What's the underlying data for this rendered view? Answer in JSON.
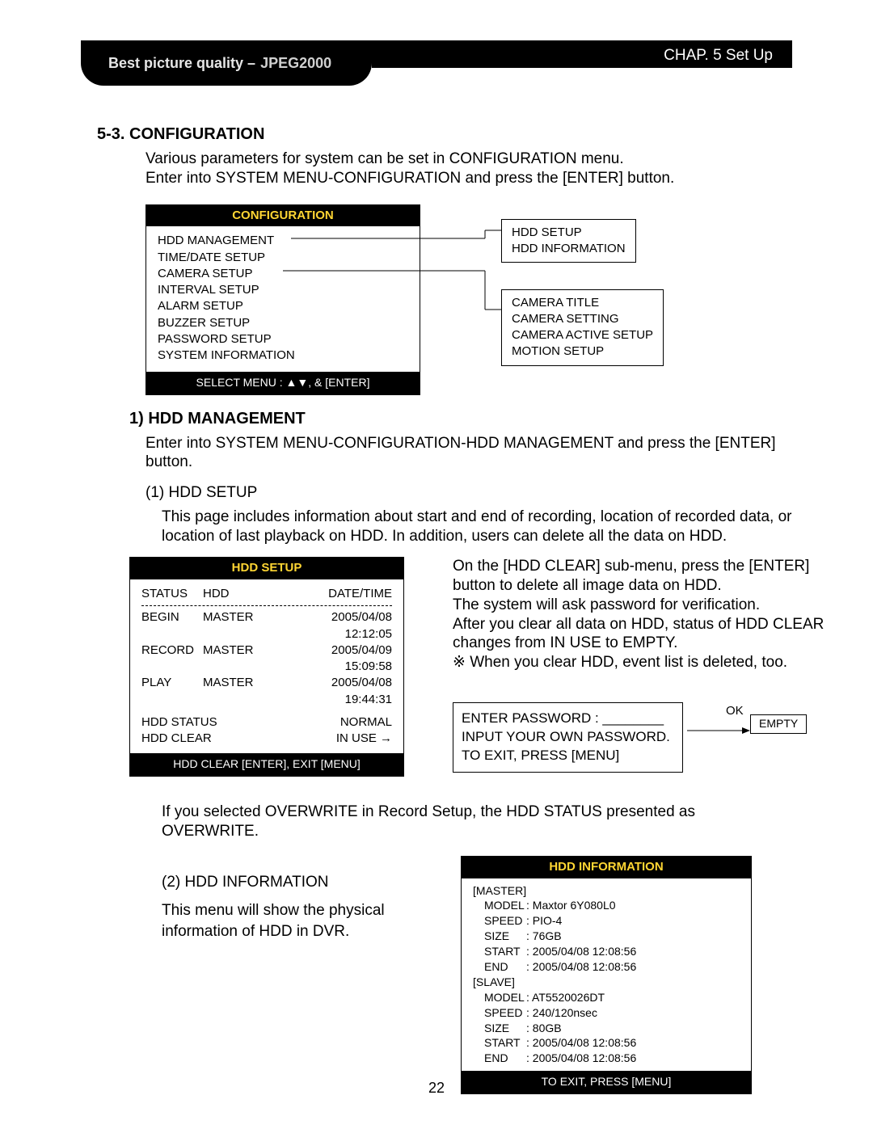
{
  "header": {
    "tagline_prefix": "Best picture quality – ",
    "tagline_em": "JPEG2000",
    "chapter": "CHAP. 5  Set Up"
  },
  "section": {
    "title": "5-3. CONFIGURATION",
    "intro": "Various parameters for system can be set in CONFIGURATION menu.\nEnter into SYSTEM MENU-CONFIGURATION and press the [ENTER] button."
  },
  "cfg_menu": {
    "title": "CONFIGURATION",
    "items": [
      "HDD MANAGEMENT",
      "TIME/DATE SETUP",
      "CAMERA SETUP",
      "INTERVAL SETUP",
      "ALARM SETUP",
      "BUZZER SETUP",
      "PASSWORD SETUP",
      "SYSTEM INFORMATION"
    ],
    "footer": "SELECT MENU : ▲▼, & [ENTER]",
    "sub_hdd": [
      "HDD SETUP",
      "HDD INFORMATION"
    ],
    "sub_cam": [
      "CAMERA TITLE",
      "CAMERA SETTING",
      "CAMERA ACTIVE SETUP",
      "MOTION SETUP"
    ]
  },
  "hdd_section": {
    "title": "1) HDD MANAGEMENT",
    "intro": "Enter into SYSTEM MENU-CONFIGURATION-HDD MANAGEMENT and press the [ENTER] button.",
    "sub1_label": "(1) HDD SETUP",
    "sub1_para": "This page includes information about start and end of recording, location of recorded data, or location of last playback on HDD. In addition,  users can delete all the data on HDD."
  },
  "hdd_setup_box": {
    "title": "HDD SETUP",
    "cols": [
      "STATUS",
      "HDD",
      "DATE/TIME"
    ],
    "rows": [
      {
        "status": "BEGIN",
        "hdd": "MASTER",
        "date": "2005/04/08",
        "time": "12:12:05"
      },
      {
        "status": "RECORD",
        "hdd": "MASTER",
        "date": "2005/04/09",
        "time": "15:09:58"
      },
      {
        "status": "PLAY",
        "hdd": "MASTER",
        "date": "2005/04/08",
        "time": "19:44:31"
      }
    ],
    "hdd_status_label": "HDD STATUS",
    "hdd_status_value": "NORMAL",
    "hdd_clear_label": "HDD CLEAR",
    "hdd_clear_value": "IN USE",
    "footer": "HDD CLEAR [ENTER], EXIT [MENU]"
  },
  "hdd_setup_right": {
    "para": "On the [HDD CLEAR] sub-menu, press the [ENTER] button to delete all image data on HDD.\nThe system will ask password for verification.\nAfter you clear all data on HDD, status of HDD CLEAR changes from IN USE to EMPTY.\n※ When you clear HDD, event list is deleted, too.",
    "pw_line1": "ENTER PASSWORD : ________",
    "pw_line2": "INPUT YOUR OWN PASSWORD.",
    "pw_line3": "TO EXIT, PRESS [MENU]",
    "ok_label": "OK",
    "ok_value": "EMPTY"
  },
  "overwrite_note": "If you selected OVERWRITE in Record Setup, the HDD STATUS presented as OVERWRITE.",
  "hdd_info": {
    "left_label": "(2) HDD INFORMATION",
    "left_text": "This menu will show the physical information of HDD in DVR.",
    "title": "HDD INFORMATION",
    "master_label": "[MASTER]",
    "slave_label": "[SLAVE]",
    "master": {
      "MODEL": "Maxtor 6Y080L0",
      "SPEED": "PIO-4",
      "SIZE": "76GB",
      "START": "2005/04/08 12:08:56",
      "END": "2005/04/08 12:08:56"
    },
    "slave": {
      "MODEL": "AT5520026DT",
      "SPEED": "240/120nsec",
      "SIZE": "80GB",
      "START": "2005/04/08 12:08:56",
      "END": "2005/04/08 12:08:56"
    },
    "footer": "TO EXIT, PRESS [MENU]"
  },
  "page_number": "22"
}
